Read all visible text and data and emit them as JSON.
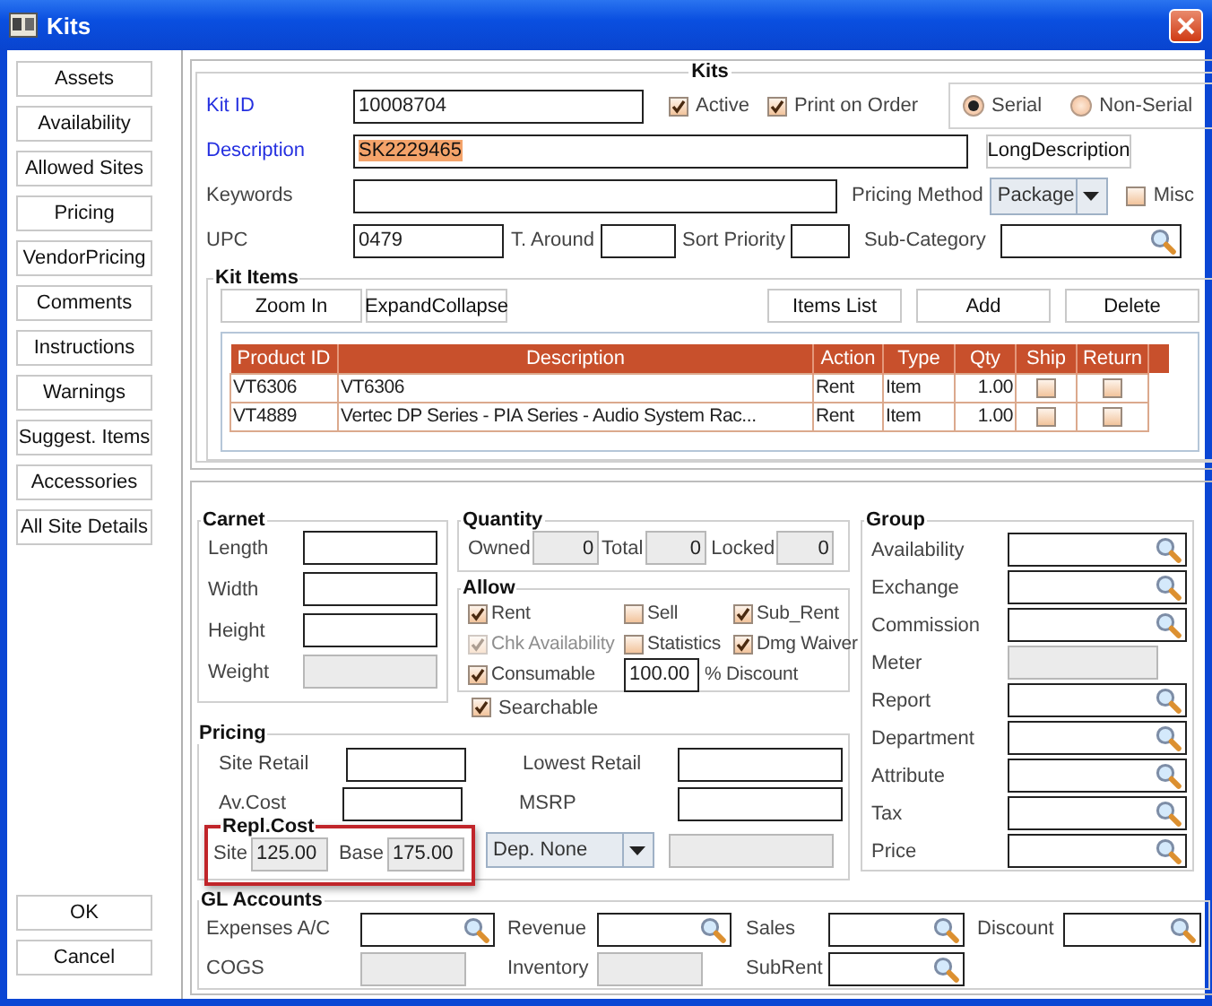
{
  "window": {
    "title": "Kits"
  },
  "sidebar": {
    "buttons": [
      "Assets",
      "Availability",
      "Allowed Sites",
      "Pricing",
      "VendorPricing",
      "Comments",
      "Instructions",
      "Warnings",
      "Suggest. Items",
      "Accessories",
      "All Site Details"
    ],
    "footer_buttons": [
      "OK",
      "Cancel"
    ]
  },
  "kits": {
    "title": "Kits",
    "kit_id": {
      "label": "Kit ID",
      "value": "10008704"
    },
    "flags": [
      {
        "label": "Active",
        "checked": true
      },
      {
        "label": "Print on Order",
        "checked": true
      }
    ],
    "tracking": [
      {
        "label": "Serial",
        "selected": true
      },
      {
        "label": "Non-Serial",
        "selected": false
      }
    ],
    "description": {
      "label": "Description",
      "value": "SK2229465",
      "highlighted": true
    },
    "long_description_button": "LongDescription",
    "keywords": {
      "label": "Keywords"
    },
    "pricing_method": {
      "label": "Pricing Method",
      "value": "Package"
    },
    "misc": {
      "label": "Misc",
      "checked": false
    },
    "upc": {
      "label": "UPC",
      "value": "0479"
    },
    "t_around": {
      "label": "T. Around"
    },
    "sort_priority": {
      "label": "Sort Priority"
    },
    "sub_category": {
      "label": "Sub-Category"
    }
  },
  "kit_items": {
    "title": "Kit Items",
    "left_buttons": [
      "Zoom In",
      "ExpandCollapse"
    ],
    "right_buttons": [
      "Items List",
      "Add",
      "Delete"
    ],
    "columns": [
      "Product ID",
      "Description",
      "Action",
      "Type",
      "Qty",
      "Ship",
      "Return"
    ],
    "rows": [
      {
        "product_id": "VT6306",
        "description": "VT6306",
        "action": "Rent",
        "type": "Item",
        "qty": "1.00",
        "ship": false,
        "return": false
      },
      {
        "product_id": "VT4889",
        "description": "Vertec DP Series - PIA Series - Audio System Rac...",
        "action": "Rent",
        "type": "Item",
        "qty": "1.00",
        "ship": false,
        "return": false
      }
    ]
  },
  "carnet": {
    "title": "Carnet",
    "fields": [
      {
        "label": "Length",
        "kind": "text"
      },
      {
        "label": "Width",
        "kind": "text"
      },
      {
        "label": "Height",
        "kind": "text"
      },
      {
        "label": "Weight",
        "kind": "readonly"
      }
    ]
  },
  "quantity": {
    "title": "Quantity",
    "fields": [
      {
        "label": "Owned",
        "value": "0"
      },
      {
        "label": "Total",
        "value": "0"
      },
      {
        "label": "Locked",
        "value": "0"
      }
    ]
  },
  "allow": {
    "title": "Allow",
    "options": [
      {
        "label": "Rent",
        "checked": true,
        "disabled": false
      },
      {
        "label": "Sell",
        "checked": false,
        "disabled": false
      },
      {
        "label": "Sub_Rent",
        "checked": true,
        "disabled": false
      },
      {
        "label": "Chk Availability",
        "checked": true,
        "disabled": true
      },
      {
        "label": "Statistics",
        "checked": false,
        "disabled": false
      },
      {
        "label": "Dmg Waiver",
        "checked": true,
        "disabled": false
      },
      {
        "label": "Consumable",
        "checked": true,
        "disabled": false
      }
    ],
    "discount": {
      "value": "100.00",
      "label": "% Discount"
    }
  },
  "searchable": {
    "label": "Searchable",
    "checked": true
  },
  "pricing": {
    "title": "Pricing",
    "fields": [
      {
        "label": "Site Retail"
      },
      {
        "label": "Lowest Retail"
      },
      {
        "label": "Av.Cost"
      },
      {
        "label": "MSRP"
      }
    ],
    "repl_cost": {
      "title": "Repl.Cost",
      "highlighted": true,
      "fields": [
        {
          "label": "Site",
          "value": "125.00"
        },
        {
          "label": "Base",
          "value": "175.00"
        }
      ]
    },
    "department": {
      "value": "Dep. None"
    }
  },
  "group": {
    "title": "Group",
    "fields": [
      {
        "label": "Availability",
        "kind": "lookup"
      },
      {
        "label": "Exchange",
        "kind": "lookup"
      },
      {
        "label": "Commission",
        "kind": "lookup"
      },
      {
        "label": "Meter",
        "kind": "readonly"
      },
      {
        "label": "Report",
        "kind": "lookup"
      },
      {
        "label": "Department",
        "kind": "lookup"
      },
      {
        "label": "Attribute",
        "kind": "lookup"
      },
      {
        "label": "Tax",
        "kind": "lookup"
      },
      {
        "label": "Price",
        "kind": "lookup"
      }
    ]
  },
  "gl_accounts": {
    "title": "GL Accounts",
    "fields": [
      {
        "label": "Expenses A/C",
        "kind": "lookup"
      },
      {
        "label": "Revenue",
        "kind": "lookup"
      },
      {
        "label": "Sales",
        "kind": "lookup"
      },
      {
        "label": "Discount",
        "kind": "lookup"
      },
      {
        "label": "COGS",
        "kind": "readonly"
      },
      {
        "label": "Inventory",
        "kind": "readonly"
      },
      {
        "label": "SubRent",
        "kind": "lookup"
      }
    ]
  }
}
